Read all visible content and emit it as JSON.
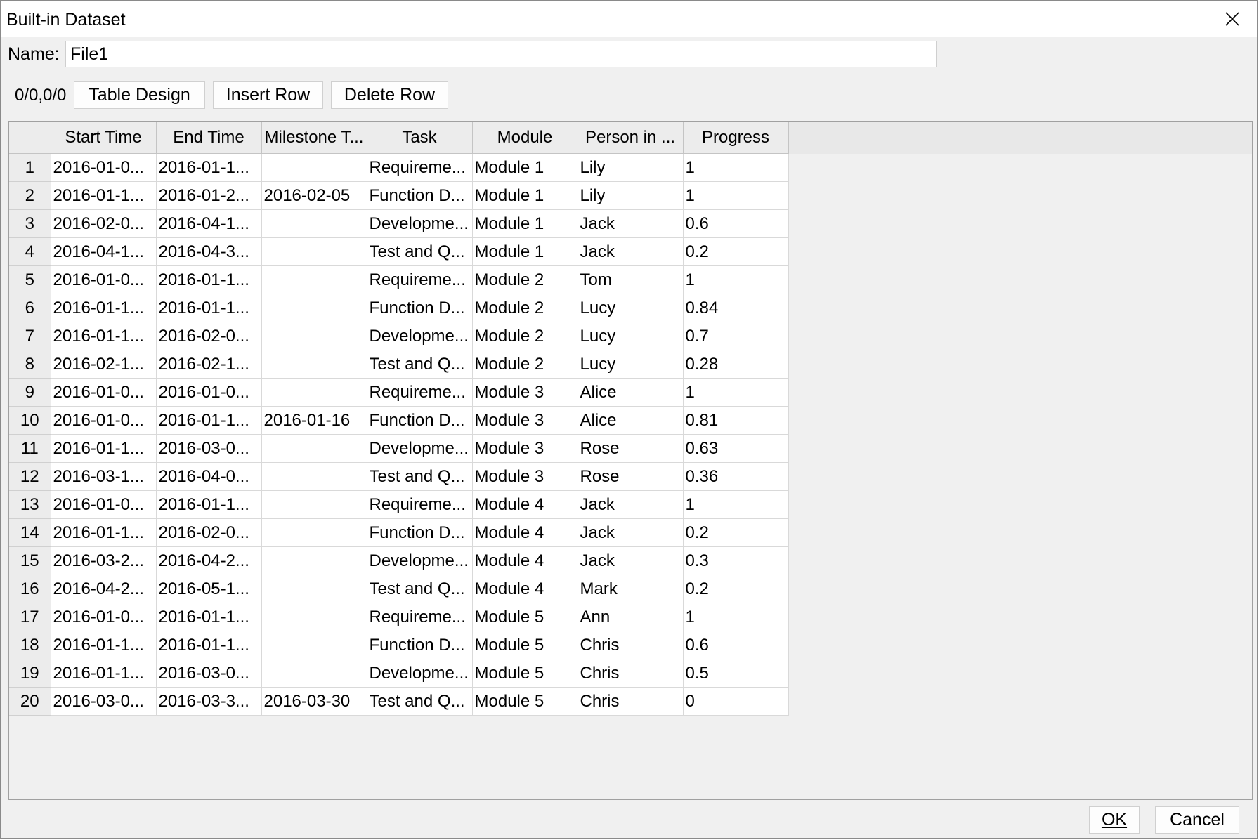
{
  "window": {
    "title": "Built-in Dataset",
    "close_icon": "close-icon"
  },
  "name_field": {
    "label": "Name:",
    "value": "File1"
  },
  "toolbar": {
    "counter": "0/0,0/0",
    "table_design_label": "Table Design",
    "insert_row_label": "Insert Row",
    "delete_row_label": "Delete Row"
  },
  "table": {
    "columns": [
      "Start Time",
      "End Time",
      "Milestone T...",
      "Task",
      "Module",
      "Person in ...",
      "Progress"
    ],
    "rows": [
      {
        "num": "1",
        "start": "2016-01-0...",
        "end": "2016-01-1...",
        "milestone": "",
        "task": "Requireme...",
        "module": "Module 1",
        "person": "Lily",
        "progress": "1"
      },
      {
        "num": "2",
        "start": "2016-01-1...",
        "end": "2016-01-2...",
        "milestone": "2016-02-05",
        "task": "Function D...",
        "module": "Module 1",
        "person": "Lily",
        "progress": "1"
      },
      {
        "num": "3",
        "start": "2016-02-0...",
        "end": "2016-04-1...",
        "milestone": "",
        "task": "Developme...",
        "module": "Module 1",
        "person": "Jack",
        "progress": "0.6"
      },
      {
        "num": "4",
        "start": "2016-04-1...",
        "end": "2016-04-3...",
        "milestone": "",
        "task": "Test and Q...",
        "module": "Module 1",
        "person": "Jack",
        "progress": "0.2"
      },
      {
        "num": "5",
        "start": "2016-01-0...",
        "end": "2016-01-1...",
        "milestone": "",
        "task": "Requireme...",
        "module": "Module 2",
        "person": "Tom",
        "progress": "1"
      },
      {
        "num": "6",
        "start": "2016-01-1...",
        "end": "2016-01-1...",
        "milestone": "",
        "task": "Function D...",
        "module": "Module 2",
        "person": "Lucy",
        "progress": "0.84"
      },
      {
        "num": "7",
        "start": "2016-01-1...",
        "end": "2016-02-0...",
        "milestone": "",
        "task": "Developme...",
        "module": "Module 2",
        "person": "Lucy",
        "progress": "0.7"
      },
      {
        "num": "8",
        "start": "2016-02-1...",
        "end": "2016-02-1...",
        "milestone": "",
        "task": "Test and Q...",
        "module": "Module 2",
        "person": "Lucy",
        "progress": "0.28"
      },
      {
        "num": "9",
        "start": "2016-01-0...",
        "end": "2016-01-0...",
        "milestone": "",
        "task": "Requireme...",
        "module": "Module 3",
        "person": "Alice",
        "progress": "1"
      },
      {
        "num": "10",
        "start": "2016-01-0...",
        "end": "2016-01-1...",
        "milestone": "2016-01-16",
        "task": "Function D...",
        "module": "Module 3",
        "person": "Alice",
        "progress": "0.81"
      },
      {
        "num": "11",
        "start": "2016-01-1...",
        "end": "2016-03-0...",
        "milestone": "",
        "task": "Developme...",
        "module": "Module 3",
        "person": "Rose",
        "progress": "0.63"
      },
      {
        "num": "12",
        "start": "2016-03-1...",
        "end": "2016-04-0...",
        "milestone": "",
        "task": "Test and Q...",
        "module": "Module 3",
        "person": "Rose",
        "progress": "0.36"
      },
      {
        "num": "13",
        "start": "2016-01-0...",
        "end": "2016-01-1...",
        "milestone": "",
        "task": "Requireme...",
        "module": "Module 4",
        "person": "Jack",
        "progress": "1"
      },
      {
        "num": "14",
        "start": "2016-01-1...",
        "end": "2016-02-0...",
        "milestone": "",
        "task": "Function D...",
        "module": "Module 4",
        "person": "Jack",
        "progress": "0.2"
      },
      {
        "num": "15",
        "start": "2016-03-2...",
        "end": "2016-04-2...",
        "milestone": "",
        "task": "Developme...",
        "module": "Module 4",
        "person": "Jack",
        "progress": "0.3"
      },
      {
        "num": "16",
        "start": "2016-04-2...",
        "end": "2016-05-1...",
        "milestone": "",
        "task": "Test and Q...",
        "module": "Module 4",
        "person": "Mark",
        "progress": "0.2"
      },
      {
        "num": "17",
        "start": "2016-01-0...",
        "end": "2016-01-1...",
        "milestone": "",
        "task": "Requireme...",
        "module": "Module 5",
        "person": "Ann",
        "progress": "1"
      },
      {
        "num": "18",
        "start": "2016-01-1...",
        "end": "2016-01-1...",
        "milestone": "",
        "task": "Function D...",
        "module": "Module 5",
        "person": "Chris",
        "progress": "0.6"
      },
      {
        "num": "19",
        "start": "2016-01-1...",
        "end": "2016-03-0...",
        "milestone": "",
        "task": "Developme...",
        "module": "Module 5",
        "person": "Chris",
        "progress": "0.5"
      },
      {
        "num": "20",
        "start": "2016-03-0...",
        "end": "2016-03-3...",
        "milestone": "2016-03-30",
        "task": "Test and Q...",
        "module": "Module 5",
        "person": "Chris",
        "progress": "0"
      }
    ]
  },
  "footer": {
    "ok_label": "OK",
    "cancel_label": "Cancel"
  }
}
